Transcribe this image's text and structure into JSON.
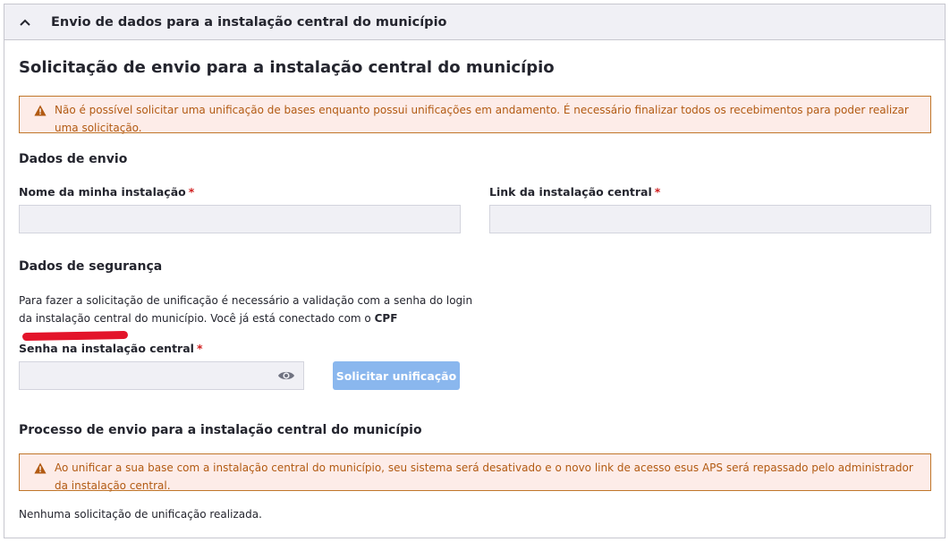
{
  "header": {
    "title": "Envio de dados para a instalação central do município",
    "toggle_icon": "chevron-up-icon"
  },
  "page": {
    "title": "Solicitação de envio para a instalação central do município"
  },
  "alert_top": {
    "text": "Não é possível solicitar uma unificação de bases enquanto possui unificações em andamento. É necessário finalizar todos os recebimentos para poder realizar uma solicitação.",
    "icon": "warning-icon"
  },
  "dados_envio": {
    "title": "Dados de envio",
    "nome_label": "Nome da minha instalação",
    "nome_value": "",
    "link_label": "Link da instalação central",
    "link_value": "",
    "required_mark": "*"
  },
  "dados_seguranca": {
    "title": "Dados de segurança",
    "description": "Para fazer a solicitação de unificação é necessário a validação com a senha do login da instalação central do município. Você já está conectado com o",
    "cpf_label": "CPF",
    "senha_label": "Senha na instalação central",
    "senha_value": "",
    "show_password_icon": "eye-icon",
    "submit_label": "Solicitar unificação"
  },
  "processo": {
    "title": "Processo de envio para a instalação central do município",
    "alert_text": "Ao unificar a sua base com a instalação central do município, seu sistema será desativado e o novo link de acesso esus APS será repassado pelo administrador da instalação central.",
    "empty_text": "Nenhuma solicitação de unificação realizada."
  },
  "colors": {
    "alert_border": "#c0762a",
    "alert_bg": "#fdece8",
    "button_disabled": "#8ab7ee",
    "required": "#d01e1e"
  }
}
